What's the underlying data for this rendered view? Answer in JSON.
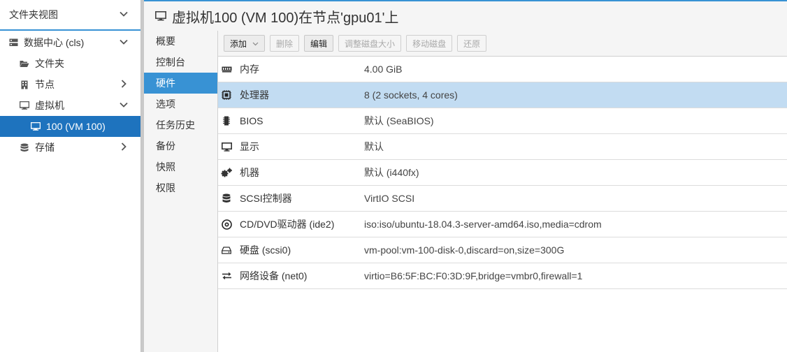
{
  "tree": {
    "header": "文件夹视图",
    "items": [
      {
        "label": "数据中心 (cls)",
        "icon": "server-icon"
      },
      {
        "label": "文件夹",
        "icon": "folder-open-icon"
      },
      {
        "label": "节点",
        "icon": "building-icon"
      },
      {
        "label": "虚拟机",
        "icon": "desktop-icon"
      },
      {
        "label": "100 (VM 100)",
        "icon": "desktop-icon"
      },
      {
        "label": "存储",
        "icon": "database-icon"
      }
    ]
  },
  "title": "虚拟机100 (VM 100)在节点'gpu01'上",
  "subnav": {
    "items": [
      "概要",
      "控制台",
      "硬件",
      "选项",
      "任务历史",
      "备份",
      "快照",
      "权限"
    ],
    "active": "硬件"
  },
  "toolbar": {
    "add": "添加",
    "remove": "删除",
    "edit": "编辑",
    "resize": "调整磁盘大小",
    "move": "移动磁盘",
    "revert": "还原"
  },
  "hardware": [
    {
      "name": "内存",
      "value": "4.00 GiB",
      "icon": "memory-icon"
    },
    {
      "name": "处理器",
      "value": "8 (2 sockets, 4 cores)",
      "icon": "cpu-icon"
    },
    {
      "name": "BIOS",
      "value": "默认 (SeaBIOS)",
      "icon": "microchip-icon"
    },
    {
      "name": "显示",
      "value": "默认",
      "icon": "desktop-icon"
    },
    {
      "name": "机器",
      "value": "默认 (i440fx)",
      "icon": "cogs-icon"
    },
    {
      "name": "SCSI控制器",
      "value": "VirtIO SCSI",
      "icon": "database-icon"
    },
    {
      "name": "CD/DVD驱动器 (ide2)",
      "value": "iso:iso/ubuntu-18.04.3-server-amd64.iso,media=cdrom",
      "icon": "cdrom-icon"
    },
    {
      "name": "硬盘 (scsi0)",
      "value": "vm-pool:vm-100-disk-0,discard=on,size=300G",
      "icon": "hdd-icon"
    },
    {
      "name": "网络设备 (net0)",
      "value": "virtio=B6:5F:BC:F0:3D:9F,bridge=vmbr0,firewall=1",
      "icon": "exchange-icon"
    }
  ],
  "colors": {
    "accent": "#3892d4",
    "tree_selected": "#1e73be",
    "row_selected": "#c2dcf2"
  }
}
